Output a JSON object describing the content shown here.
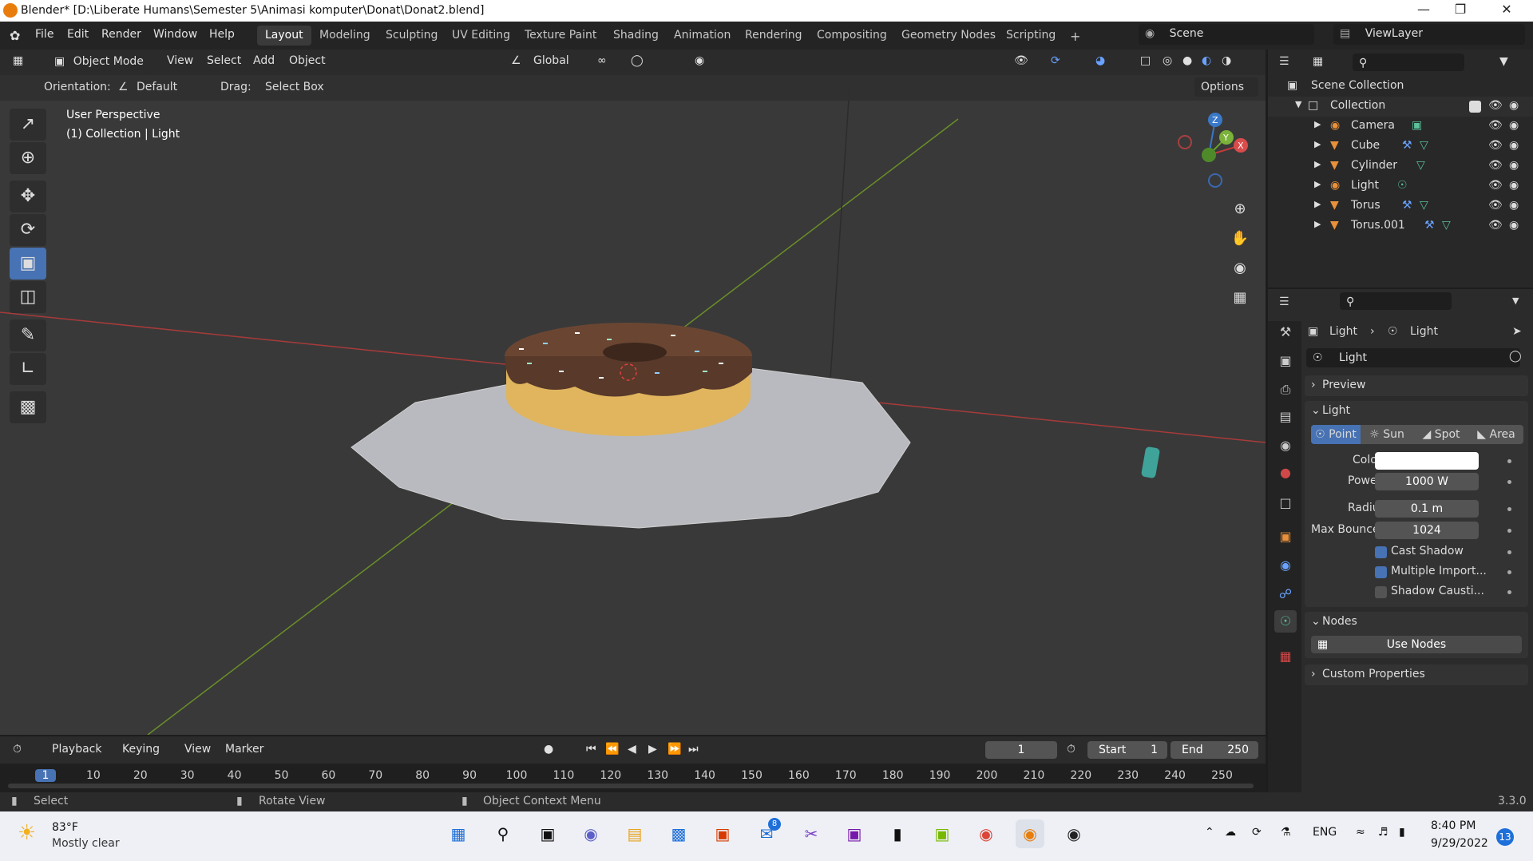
{
  "title": "Blender* [D:\\Liberate Humans\\Semester 5\\Animasi komputer\\Donat\\Donat2.blend]",
  "menu": [
    "File",
    "Edit",
    "Render",
    "Window",
    "Help"
  ],
  "workspaces": [
    "Layout",
    "Modeling",
    "Sculpting",
    "UV Editing",
    "Texture Paint",
    "Shading",
    "Animation",
    "Rendering",
    "Compositing",
    "Geometry Nodes",
    "Scripting"
  ],
  "active_workspace": "Layout",
  "scene": "Scene",
  "view_layer": "ViewLayer",
  "header3d": {
    "mode": "Object Mode",
    "menus": [
      "View",
      "Select",
      "Add",
      "Object"
    ],
    "transform": "Global"
  },
  "toolsettings": {
    "orientation_label": "Orientation:",
    "orientation": "Default",
    "drag_label": "Drag:",
    "drag": "Select Box",
    "options": "Options"
  },
  "viewport": {
    "line1": "User Perspective",
    "line2": "(1) Collection | Light"
  },
  "gizmo": {
    "x": "X",
    "y": "Y",
    "z": "Z"
  },
  "outliner": {
    "root": "Scene Collection",
    "collection": "Collection",
    "items": [
      "Camera",
      "Cube",
      "Cylinder",
      "Light",
      "Torus",
      "Torus.001"
    ]
  },
  "props": {
    "crumb_obj": "Light",
    "crumb_data": "Light",
    "datablock": "Light",
    "preview": "Preview",
    "light_panel": "Light",
    "types": [
      "Point",
      "Sun",
      "Spot",
      "Area"
    ],
    "color_label": "Color",
    "power_label": "Power",
    "power": "1000 W",
    "radius_label": "Radius",
    "radius": "0.1 m",
    "bounces_label": "Max Bounces",
    "bounces": "1024",
    "cast_shadow": "Cast Shadow",
    "multiple_import": "Multiple Import...",
    "shadow_caustics": "Shadow Causti...",
    "nodes": "Nodes",
    "use_nodes": "Use Nodes",
    "custom_props": "Custom Properties"
  },
  "timeline": {
    "menus": [
      "Playback",
      "Keying",
      "View",
      "Marker"
    ],
    "current": "1",
    "start_label": "Start",
    "start": "1",
    "end_label": "End",
    "end": "250",
    "ticks": [
      "1",
      "10",
      "20",
      "30",
      "40",
      "50",
      "60",
      "70",
      "80",
      "90",
      "100",
      "110",
      "120",
      "130",
      "140",
      "150",
      "160",
      "170",
      "180",
      "190",
      "200",
      "210",
      "220",
      "230",
      "240",
      "250"
    ]
  },
  "status": {
    "select": "Select",
    "rotate": "Rotate View",
    "context": "Object Context Menu",
    "version": "3.3.0"
  },
  "taskbar": {
    "temp": "83°F",
    "weather": "Mostly clear",
    "lang": "ENG",
    "time": "8:40 PM",
    "date": "9/29/2022",
    "badge": "13",
    "mail_badge": "8"
  }
}
